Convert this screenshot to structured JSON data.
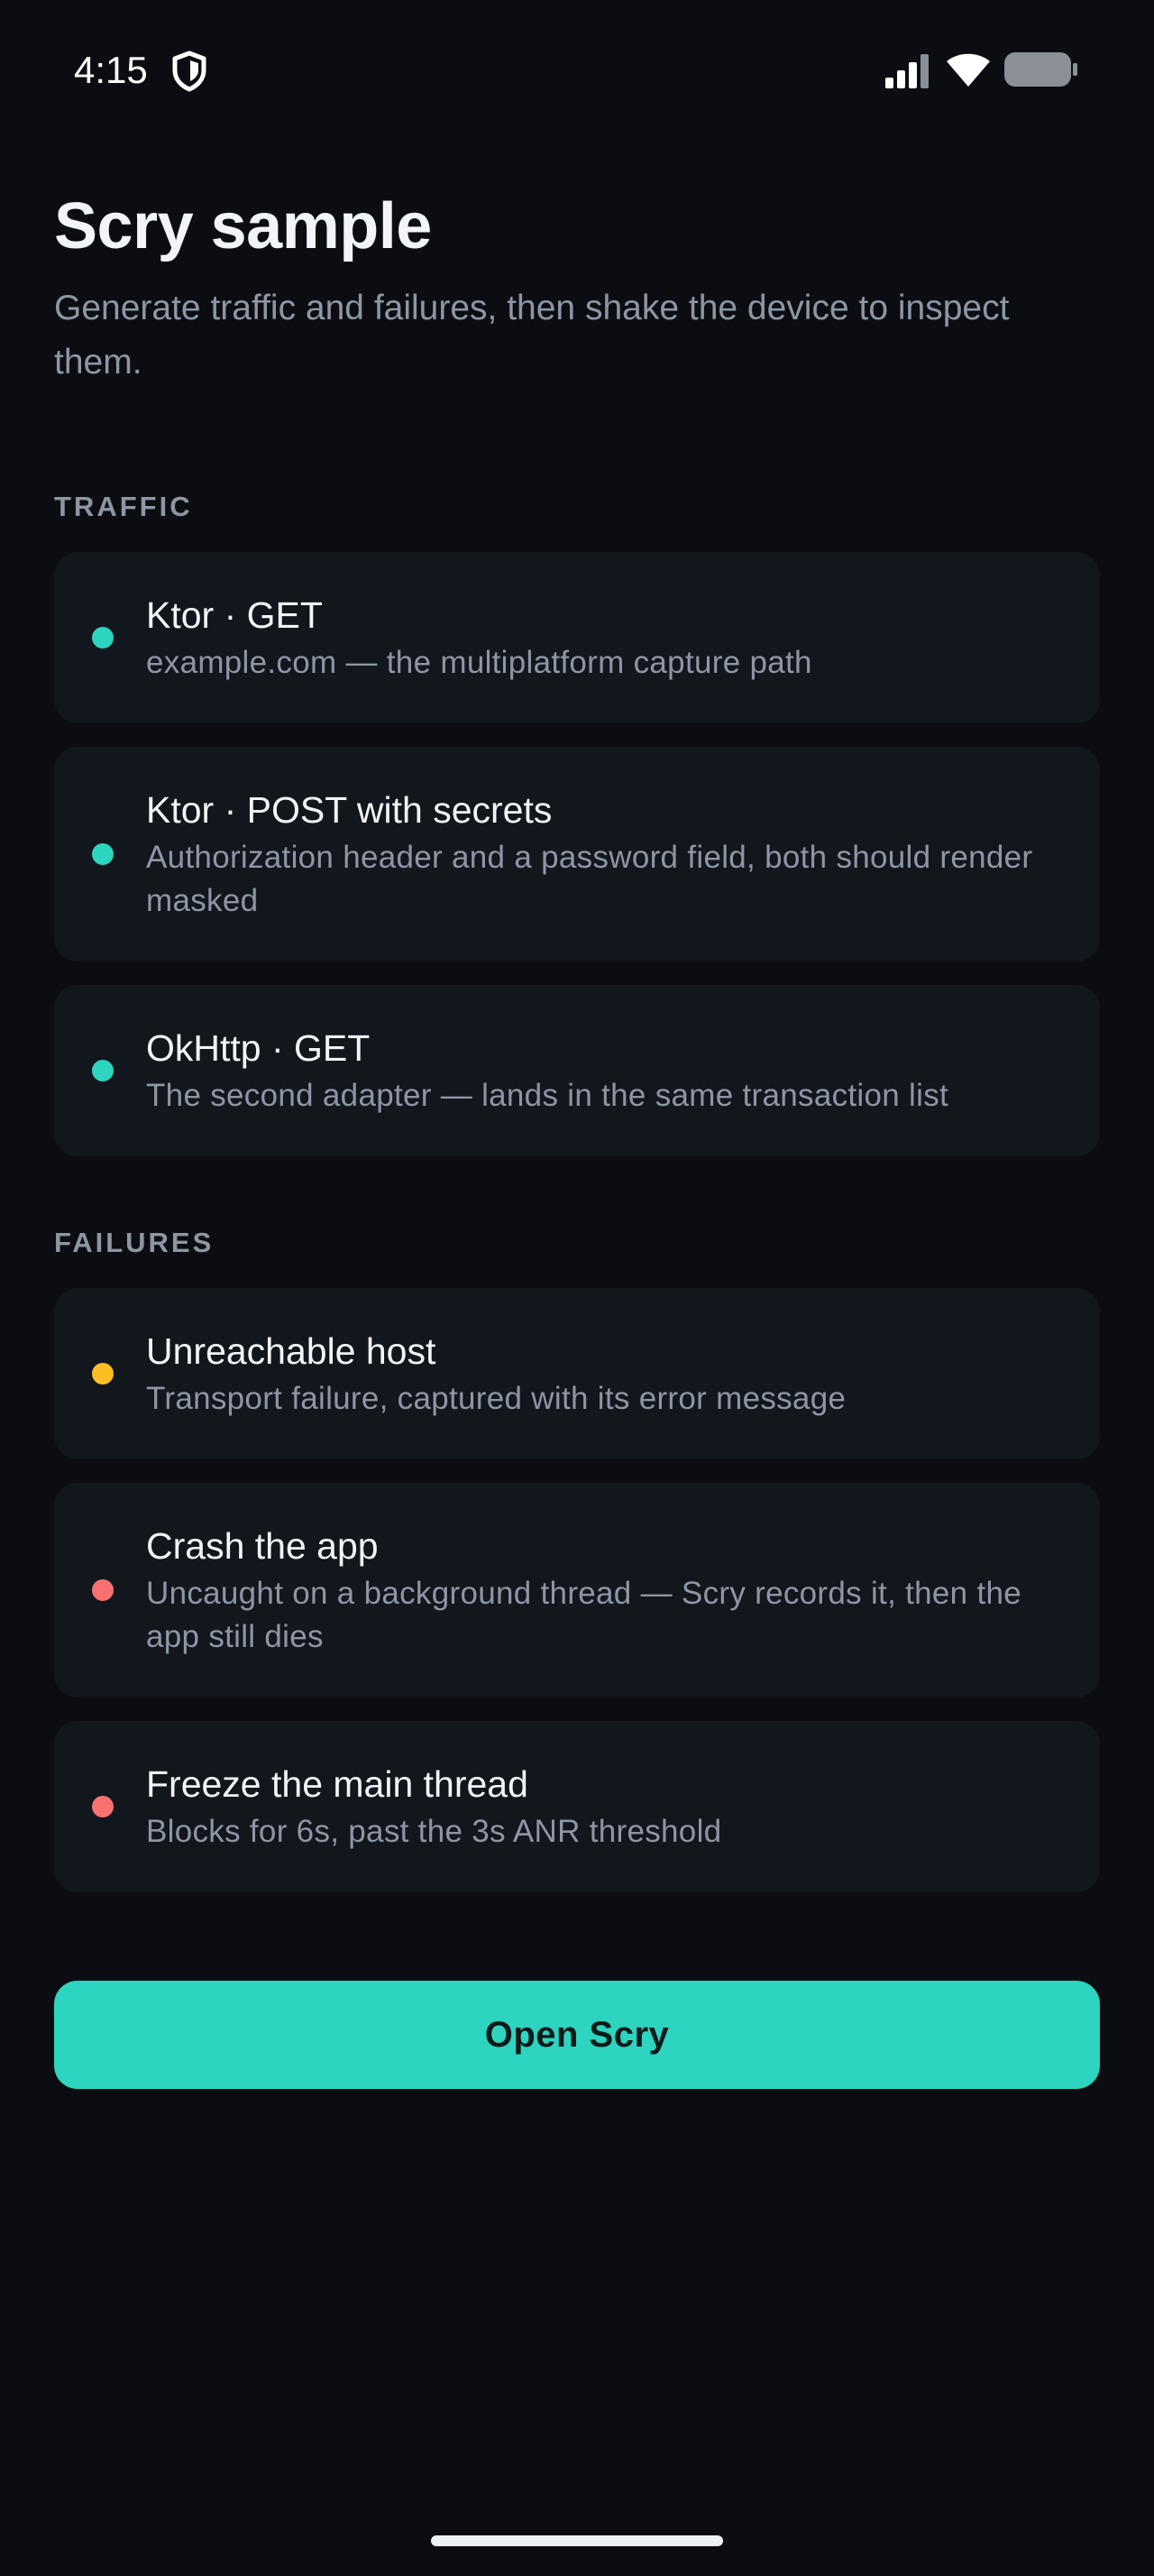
{
  "status_bar": {
    "time": "4:15",
    "icons": [
      "shield-icon",
      "signal-icon",
      "wifi-icon",
      "battery-icon"
    ]
  },
  "header": {
    "title": "Scry sample",
    "subtitle": "Generate traffic and failures, then shake the device to inspect them."
  },
  "sections": {
    "traffic": {
      "label": "TRAFFIC",
      "items": [
        {
          "title": "Ktor · GET",
          "desc": "example.com — the multiplatform capture path",
          "dot_color": "#2dd4bf"
        },
        {
          "title": "Ktor · POST with secrets",
          "desc": "Authorization header and a password field, both should render masked",
          "dot_color": "#2dd4bf"
        },
        {
          "title": "OkHttp · GET",
          "desc": "The second adapter — lands in the same transaction list",
          "dot_color": "#2dd4bf"
        }
      ]
    },
    "failures": {
      "label": "FAILURES",
      "items": [
        {
          "title": "Unreachable host",
          "desc": "Transport failure, captured with its error message",
          "dot_color": "#fbbf24"
        },
        {
          "title": "Crash the app",
          "desc": "Uncaught on a background thread — Scry records it, then the app still dies",
          "dot_color": "#f87171"
        },
        {
          "title": "Freeze the main thread",
          "desc": "Blocks for 6s, past the 3s ANR threshold",
          "dot_color": "#f87171"
        }
      ]
    }
  },
  "actions": {
    "open_label": "Open Scry"
  },
  "colors": {
    "background": "#0b0d12",
    "card": "#12161d",
    "accent": "#2dd4bf",
    "warning": "#fbbf24",
    "danger": "#f87171"
  }
}
